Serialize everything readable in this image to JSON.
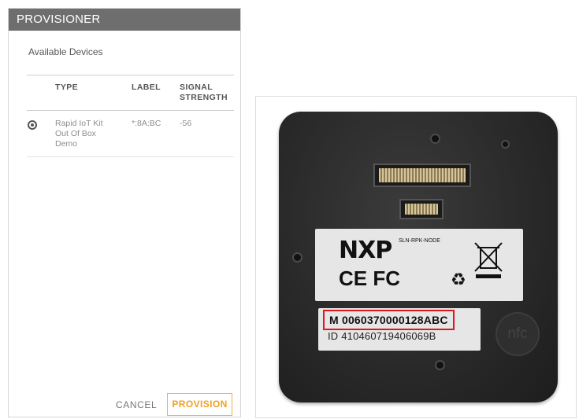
{
  "dialog": {
    "title": "PROVISIONER",
    "section_title": "Available Devices",
    "columns": {
      "type": "TYPE",
      "label": "LABEL",
      "signal": "SIGNAL STRENGTH"
    },
    "devices": [
      {
        "type": "Rapid IoT Kit Out Of Box Demo",
        "label": "*:8A:BC",
        "signal": "-56",
        "selected": true
      }
    ],
    "cancel_label": "CANCEL",
    "provision_label": "PROVISION"
  },
  "photo": {
    "brand": "NXP",
    "model": "SLN-RPK-NODE",
    "cert_marks": "CE FC",
    "serial_m": "M 0060370000128ABC",
    "serial_id": "ID 410460719406069B",
    "nfc_text": "nfc"
  },
  "colors": {
    "header_bg": "#6e6e6e",
    "accent": "#f0a020",
    "highlight_box": "#e0161b"
  }
}
